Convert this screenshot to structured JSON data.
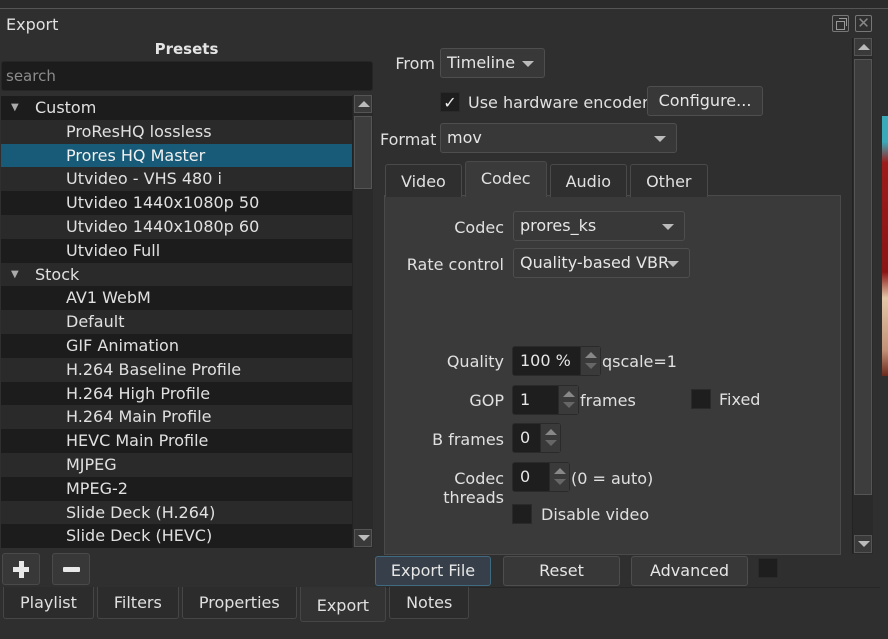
{
  "dock": {
    "title": "Export",
    "float_icon": "float-icon",
    "close_icon": "close-icon"
  },
  "presets": {
    "title": "Presets",
    "search_placeholder": "search",
    "search_value": "",
    "groups": [
      {
        "label": "Custom",
        "expanded": true,
        "items": [
          "ProResHQ lossless",
          "Prores HQ Master",
          "Utvideo - VHS 480 i",
          "Utvideo 1440x1080p 50",
          "Utvideo 1440x1080p 60",
          "Utvideo Full"
        ]
      },
      {
        "label": "Stock",
        "expanded": true,
        "items": [
          "AV1 WebM",
          "Default",
          "GIF Animation",
          "H.264 Baseline Profile",
          "H.264 High Profile",
          "H.264 Main Profile",
          "HEVC Main Profile",
          "MJPEG",
          "MPEG-2",
          "Slide Deck (H.264)",
          "Slide Deck (HEVC)"
        ]
      }
    ],
    "selected": "Prores HQ Master",
    "add_icon": "plus-icon",
    "remove_icon": "minus-icon"
  },
  "export": {
    "from_label": "From",
    "from_value": "Timeline",
    "hw_encoder_label": "Use hardware encoder",
    "hw_encoder_checked": true,
    "check_glyph": "✓",
    "configure_label": "Configure...",
    "format_label": "Format",
    "format_value": "mov",
    "tabs": [
      "Video",
      "Codec",
      "Audio",
      "Other"
    ],
    "active_tab": "Codec",
    "codec": {
      "codec_label": "Codec",
      "codec_value": "prores_ks",
      "rate_control_label": "Rate control",
      "rate_control_value": "Quality-based VBR",
      "quality_label": "Quality",
      "quality_value": "100 %",
      "quality_suffix": "qscale=1",
      "gop_label": "GOP",
      "gop_value": "1",
      "gop_suffix": "frames",
      "fixed_label": "Fixed",
      "fixed_checked": false,
      "bframes_label": "B frames",
      "bframes_value": "0",
      "threads_label": "Codec threads",
      "threads_value": "0",
      "threads_suffix": "(0 = auto)",
      "disable_video_label": "Disable video",
      "disable_video_checked": false
    },
    "buttons": {
      "export_file": "Export File",
      "reset": "Reset",
      "advanced": "Advanced"
    }
  },
  "bottom_tabs": [
    "Playlist",
    "Filters",
    "Properties",
    "Export",
    "Notes"
  ],
  "bottom_active": "Export",
  "colors": {
    "selection": "#175b78",
    "background": "#2f2f2f",
    "panel": "#3a3a3a"
  }
}
